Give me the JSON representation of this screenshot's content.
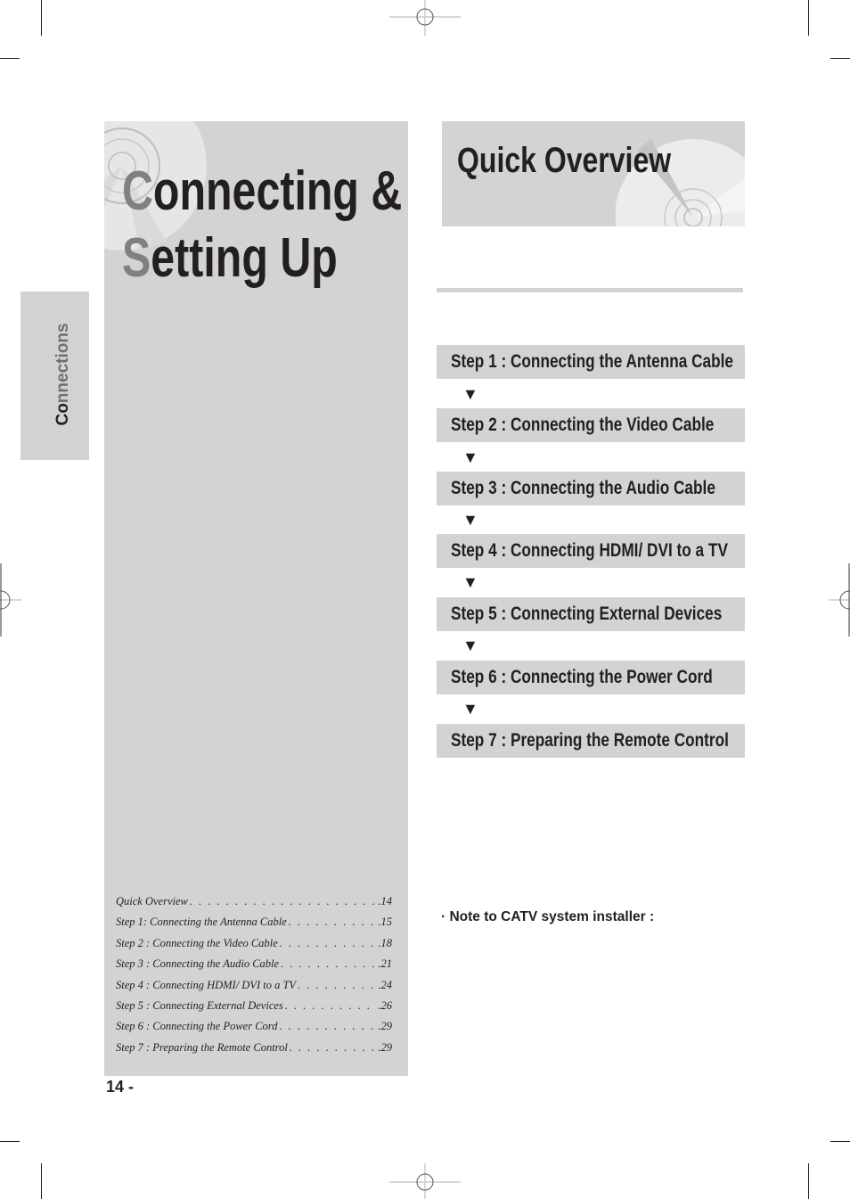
{
  "side_tab": {
    "label_first": "Co",
    "label_rest": "nnections"
  },
  "chapter": {
    "line1_initial": "C",
    "line1_rest": "onnecting &",
    "line2_initial": "S",
    "line2_rest": "etting Up"
  },
  "toc": [
    {
      "title": "Quick Overview",
      "page": ".14"
    },
    {
      "title": "Step 1: Connecting the Antenna Cable",
      "page": ".15"
    },
    {
      "title": "Step 2 : Connecting the Video Cable",
      "page": ".18"
    },
    {
      "title": "Step 3 : Connecting the Audio Cable",
      "page": ".21"
    },
    {
      "title": "Step 4 : Connecting HDMI/ DVI to a TV",
      "page": ".24"
    },
    {
      "title": "Step 5 : Connecting External Devices",
      "page": ".26"
    },
    {
      "title": "Step 6 : Connecting the Power Cord",
      "page": ".29"
    },
    {
      "title": "Step 7 : Preparing the Remote Control",
      "page": ".29"
    }
  ],
  "page_number": "14 -",
  "section": {
    "title": "Quick Overview"
  },
  "steps": [
    {
      "label": "Step 1 : Connecting the Antenna Cable"
    },
    {
      "label": "Step 2 : Connecting the Video Cable"
    },
    {
      "label": "Step 3 : Connecting the Audio Cable"
    },
    {
      "label": "Step 4 : Connecting HDMI/ DVI to a TV"
    },
    {
      "label": "Step 5 : Connecting External Devices"
    },
    {
      "label": "Step 6 : Connecting the Power Cord"
    },
    {
      "label": "Step 7 : Preparing the Remote Control"
    }
  ],
  "arrow_glyph": "▼",
  "note": "· Note to CATV system installer :",
  "colors": {
    "panel_gray": "#d3d3d3",
    "text_dark": "#231f20",
    "initial_gray": "#808080"
  }
}
